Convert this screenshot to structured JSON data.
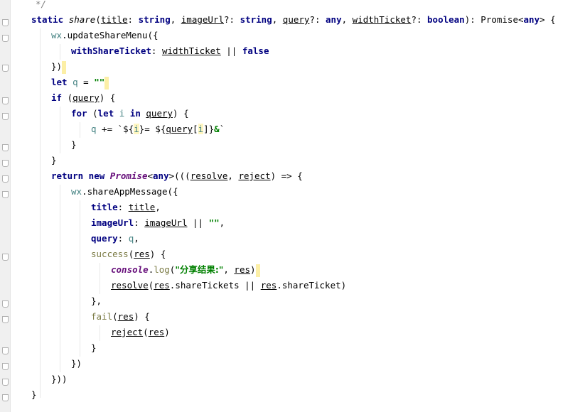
{
  "code": {
    "comment_end": "*/",
    "l1": {
      "static": "static",
      "name": "share",
      "p_open": "(",
      "title": "title",
      "c1": ": ",
      "string1": "string",
      ", ": ", ",
      "imageUrl": "imageUrl",
      "q1": "?: ",
      "string2": "string",
      "query": "query",
      "q2": "?: ",
      "any1": "any",
      "widthTicket": "widthTicket",
      "q3": "?: ",
      "boolean": "boolean",
      "tail1": "): Promise<",
      "any2": "any",
      "tail2": "> {"
    },
    "l2": {
      "wx": "wx",
      "dot": ".",
      "method": "updateShareMenu",
      "rest": "({"
    },
    "l3": {
      "prop": "withShareTicket",
      "colon": ": ",
      "param": "widthTicket",
      "or": " || ",
      "false": "false"
    },
    "l4": {
      "text": "})"
    },
    "l5": {
      "let": "let",
      "var": " q",
      "eq": " = ",
      "str": "\"\""
    },
    "l6": {
      "if": "if",
      "open": " (",
      "query": "query",
      "close": ") {"
    },
    "l7": {
      "for": "for",
      "open": " (",
      "let": "let",
      "i": " i ",
      "in": "in",
      "space": " ",
      "query": "query",
      "close": ") {"
    },
    "l8": {
      "q": "q",
      "op": " += `${",
      "i": "i",
      "mid": "}= ${",
      "query": "query",
      "br1": "[",
      "i2": "i",
      "br2": "]}",
      "amp": "&",
      "tick": "`"
    },
    "l9": {
      "text": "}"
    },
    "l10": {
      "text": "}"
    },
    "l11": {
      "return": "return",
      "new": " new ",
      "promise": "Promise",
      "lt": "<",
      "any": "any",
      "gt": ">(((",
      "resolve": "resolve",
      "comma": ", ",
      "reject": "reject",
      "arrow": ") => {"
    },
    "l12": {
      "wx": "wx",
      "dot": ".",
      "method": "shareAppMessage",
      "rest": "({"
    },
    "l13": {
      "prop": "title",
      "colon": ": ",
      "param": "title",
      "comma": ","
    },
    "l14": {
      "prop": "imageUrl",
      "colon": ": ",
      "param": "imageUrl",
      "or": " || ",
      "str": "\"\"",
      "comma": ","
    },
    "l15": {
      "prop": "query",
      "colon": ": ",
      "val": "q",
      "comma": ","
    },
    "l16": {
      "method": "success",
      "open": "(",
      "res": "res",
      "close": ") {"
    },
    "l17": {
      "console": "console",
      "dot": ".",
      "log": "log",
      "open": "(",
      "str": "\"分享结果:\"",
      "comma": ", ",
      "res": "res",
      "close": ")"
    },
    "l18": {
      "resolve": "resolve",
      "open": "(",
      "res1": "res",
      "dot1": ".shareTickets || ",
      "res2": "res",
      "dot2": ".shareTicket)"
    },
    "l19": {
      "text": "},"
    },
    "l20": {
      "method": "fail",
      "open": "(",
      "res": "res",
      "close": ") {"
    },
    "l21": {
      "reject": "reject",
      "open": "(",
      "res": "res",
      "close": ")"
    },
    "l22": {
      "text": "}"
    },
    "l23": {
      "text": "})"
    },
    "l24": {
      "text": "}))"
    },
    "l25": {
      "text": "}"
    }
  }
}
